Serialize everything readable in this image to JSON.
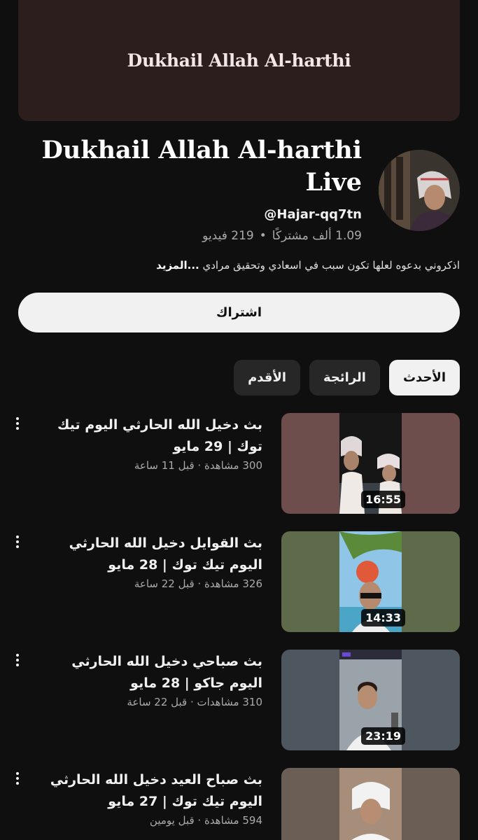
{
  "banner": {
    "text": "Dukhail Allah Al-harthi"
  },
  "channel": {
    "title": "Dukhail Allah Al-harthi Live",
    "handle": "@Hajar-qq7tn",
    "subscribers": "1.09 ألف مشتركًا",
    "separator": "•",
    "videos": "219 فيديو",
    "description": "اذكروني بدعوه لعلها تكون سبب في اسعادي وتحقيق مرادي",
    "more_label": "...المزيد"
  },
  "subscribe_label": "اشتراك",
  "chips": [
    "الأحدث",
    "الرائجة",
    "الأقدم"
  ],
  "videos": [
    {
      "title": "بث دخيل الله الحارثي اليوم تيك توك | 29 مايو",
      "meta": "300 مشاهدة · قبل 11 ساعة",
      "duration": "16:55"
    },
    {
      "title": "بث القوايل دخيل الله الحارثي اليوم تيك توك | 28 مايو",
      "meta": "326 مشاهدة · قبل 22 ساعة",
      "duration": "14:33"
    },
    {
      "title": "بث صباحي دخيل الله الحارثي اليوم جاكو | 28 مايو",
      "meta": "310 مشاهدات · قبل 22 ساعة",
      "duration": "23:19"
    },
    {
      "title": "بث صباح العيد دخيل الله الحارثي اليوم تيك توك | 27 مايو",
      "meta": "594 مشاهدة · قبل يومين",
      "duration": ""
    }
  ],
  "colors": {
    "background": "#0f0f0f",
    "banner": "#2b1e1c",
    "chip": "#272727",
    "muted": "#aaaaaa"
  },
  "icons": {
    "more": "vertical-ellipsis-icon"
  }
}
